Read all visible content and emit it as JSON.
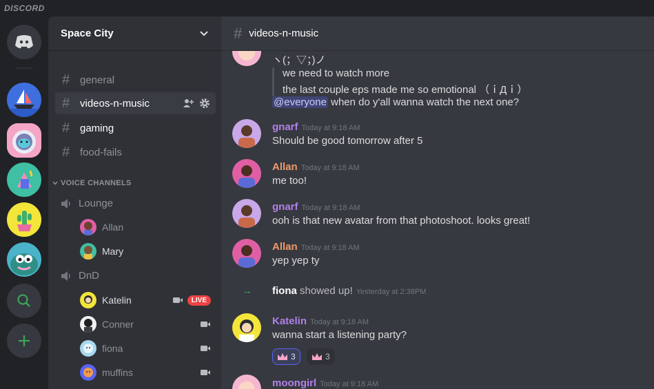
{
  "app": {
    "wordmark": "DISCORD"
  },
  "servers": [
    {
      "name": "home",
      "icon": "discord-logo-icon"
    },
    {
      "name": "boat-server",
      "icon": "sailboat-icon"
    },
    {
      "name": "space-city",
      "icon": "astronaut-icon",
      "active": true
    },
    {
      "name": "green-server",
      "icon": "gem-icon"
    },
    {
      "name": "cactus-server",
      "icon": "cactus-icon"
    },
    {
      "name": "monster-server",
      "icon": "monster-icon"
    },
    {
      "name": "explore",
      "icon": "search-icon"
    },
    {
      "name": "add-server",
      "icon": "plus-icon"
    }
  ],
  "sidebar": {
    "server_name": "Space City",
    "channels": [
      {
        "label": "general"
      },
      {
        "label": "videos-n-music"
      },
      {
        "label": "gaming"
      },
      {
        "label": "food-fails"
      }
    ],
    "voice_category": "VOICE CHANNELS",
    "voice_channels": [
      {
        "label": "Lounge",
        "users": [
          {
            "name": "Allan"
          },
          {
            "name": "Mary"
          }
        ]
      },
      {
        "label": "DnD",
        "users": [
          {
            "name": "Katelin",
            "live": "LIVE"
          },
          {
            "name": "Conner"
          },
          {
            "name": "fiona"
          },
          {
            "name": "muffins"
          }
        ]
      }
    ]
  },
  "chat": {
    "channel": "videos-n-music",
    "top_kaomoji": "ヽ(；▽；)ノ",
    "quote_lines": [
      "we need to watch more",
      "the last couple eps made me so emotional （ｉДｉ）"
    ],
    "mention": "@everyone",
    "mention_rest": " when do y'all wanna watch the next one?",
    "messages": [
      {
        "author": "gnarf",
        "time": "Today at 9:18 AM",
        "text": "Should be good tomorrow after 5"
      },
      {
        "author": "Allan",
        "time": "Today at 9:18 AM",
        "text": "me too!"
      },
      {
        "author": "gnarf",
        "time": "Today at 9:18 AM",
        "text": "ooh is that new avatar from that photoshoot. looks great!"
      },
      {
        "author": "Allan",
        "time": "Today at 9:18 AM",
        "text": "yep yep ty"
      }
    ],
    "system": {
      "user": "fiona",
      "text": " showed up!",
      "time": "Yesterday at 2:38PM"
    },
    "katelin": {
      "author": "Katelin",
      "time": "Today at 9:18 AM",
      "text": "wanna start a listening party?",
      "reactions": [
        "3",
        "3"
      ]
    },
    "last": {
      "author": "moongirl",
      "time": "Today at 9:18 AM"
    }
  },
  "colors": {
    "gnarf": "#b37feb",
    "allan": "#f0996a",
    "katelin": "#b37feb",
    "moongirl": "#b37feb"
  }
}
